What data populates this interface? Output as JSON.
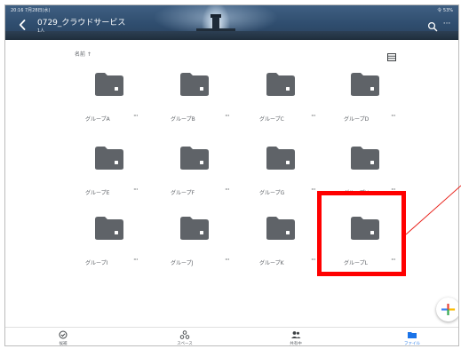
{
  "status_bar": {
    "time": "20:16  7月28日(水)",
    "battery": "令 53%"
  },
  "header": {
    "title": "0729_クラウドサービス",
    "subtitle": "1人",
    "back_icon": "chevron-left-icon",
    "search_icon": "search-icon",
    "more_label": "···"
  },
  "sort": {
    "label": "名前 ↑"
  },
  "folders": [
    {
      "name": "グループA"
    },
    {
      "name": "グループB"
    },
    {
      "name": "グループC"
    },
    {
      "name": "グループD"
    },
    {
      "name": "グループE"
    },
    {
      "name": "グループF"
    },
    {
      "name": "グループG"
    },
    {
      "name": "グループH"
    },
    {
      "name": "グループI"
    },
    {
      "name": "グループJ"
    },
    {
      "name": "グループK"
    },
    {
      "name": "グループL"
    }
  ],
  "folder_more_label": "···",
  "bottom_nav": [
    {
      "label": "候補",
      "icon": "check-circle-icon",
      "active": false
    },
    {
      "label": "スペース",
      "icon": "spaces-icon",
      "active": false
    },
    {
      "label": "共有中",
      "icon": "shared-people-icon",
      "active": false
    },
    {
      "label": "ファイル",
      "icon": "folder-icon",
      "active": true
    }
  ],
  "colors": {
    "folder": "#5f6368",
    "highlight": "#ff0000",
    "accent": "#1a73e8",
    "fab_plus": [
      "#ea4335",
      "#fbbc04",
      "#34a853",
      "#4285f4"
    ]
  }
}
